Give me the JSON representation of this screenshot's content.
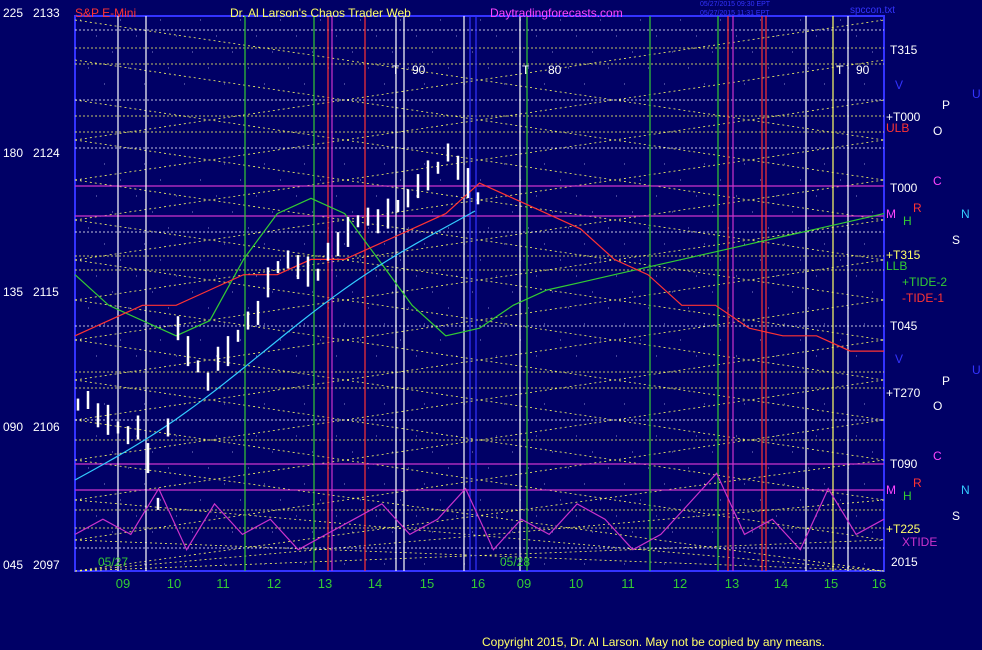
{
  "header": {
    "symbol": "S&P E-Mini",
    "title": "Dr. Al Larson's Chaos Trader Web",
    "site": "Daytradingforecasts.com",
    "stamp_line1": "05/27/2015 09:30 EPT",
    "stamp_line2": "05/27/2015 11:31 EPT",
    "file": "spccon.txt"
  },
  "footer": {
    "copyright": "Copyright 2015, Dr. Al Larson. May not be copied by any means."
  },
  "colors": {
    "background": "#000066",
    "frame": "#3333ff",
    "price": "#ffffff",
    "tide2": "#33cc33",
    "tide1": "#ff3333",
    "xtide": "#cc33cc",
    "cyan": "#33ccff",
    "yellow": "#ffff66",
    "magenta_label": "#ff44ff"
  },
  "chart_data": {
    "type": "line",
    "title": "S&P E-Mini",
    "xlabel": "",
    "ylabel": "",
    "ylim": [
      2097,
      2133
    ],
    "y_ticks": [
      {
        "deg": "225",
        "price": 2133
      },
      {
        "deg": "180",
        "price": 2124
      },
      {
        "deg": "135",
        "price": 2115
      },
      {
        "deg": "090",
        "price": 2106
      },
      {
        "deg": "045",
        "price": 2097
      }
    ],
    "x_hours": [
      "09",
      "10",
      "11",
      "12",
      "13",
      "14",
      "15",
      "16",
      "09",
      "10",
      "11",
      "12",
      "13",
      "14",
      "15",
      "16"
    ],
    "dates": [
      "05/27",
      "05/28"
    ],
    "year": "2015",
    "cycle_labels": [
      {
        "text": "T",
        "value": "90"
      },
      {
        "text": "T",
        "value": "80"
      },
      {
        "text": "T",
        "value": "90"
      }
    ],
    "right_labels": [
      {
        "text": "T315",
        "color": "#ffffff"
      },
      {
        "text": "+T000",
        "color": "#ffffff"
      },
      {
        "text": "ULB",
        "color": "#ff3333"
      },
      {
        "text": "T000",
        "color": "#ffffff"
      },
      {
        "text": "+T315",
        "color": "#ffff66"
      },
      {
        "text": "LLB",
        "color": "#33cc33"
      },
      {
        "text": "+TIDE-2",
        "color": "#33cc33"
      },
      {
        "text": "-TIDE-1",
        "color": "#ff3333"
      },
      {
        "text": "T045",
        "color": "#ffffff"
      },
      {
        "text": "+T270",
        "color": "#ffffff"
      },
      {
        "text": "T090",
        "color": "#ffffff"
      },
      {
        "text": "+T225",
        "color": "#ffff66"
      },
      {
        "text": "XTIDE",
        "color": "#cc33cc"
      }
    ],
    "planet_letters": [
      {
        "text": "V",
        "color": "#3333ff"
      },
      {
        "text": "P",
        "color": "#ffffff"
      },
      {
        "text": "U",
        "color": "#3333ff"
      },
      {
        "text": "O",
        "color": "#ffffff"
      },
      {
        "text": "C",
        "color": "#ff44ff"
      },
      {
        "text": "M",
        "color": "#ff44ff"
      },
      {
        "text": "R",
        "color": "#ff3333"
      },
      {
        "text": "H",
        "color": "#33cc33"
      },
      {
        "text": "N",
        "color": "#33ccff"
      },
      {
        "text": "S",
        "color": "#ffffff"
      }
    ],
    "series": [
      {
        "name": "S&P E-Mini",
        "values": [
          2107.5,
          2107.8,
          2106.8,
          2106.5,
          2106.0,
          2105.5,
          2106.0,
          2104.0,
          2101.0,
          2106.0,
          2112.5,
          2111.0,
          2110.0,
          2109.0,
          2110.5,
          2111.0,
          2112.0,
          2113.0,
          2113.5,
          2115.5,
          2116.5,
          2117.0,
          2116.5,
          2116.2,
          2116.0,
          2117.5,
          2118.0,
          2118.8,
          2119.5,
          2119.8,
          2119.5,
          2120.0,
          2120.5,
          2121.0,
          2121.8,
          2122.5,
          2123.0,
          2124.0,
          2123.0,
          2122.0,
          2121.0
        ]
      },
      {
        "name": "+TIDE-2",
        "values": [
          2116,
          2114,
          2113,
          2112,
          2113,
          2117,
          2120,
          2121,
          2120,
          2117,
          2114,
          2112,
          2112.5,
          2114,
          2115,
          2115.5,
          2116,
          2116.5,
          2117,
          2117.5,
          2118,
          2118.5,
          2119,
          2119.5,
          2120
        ]
      },
      {
        "name": "-TIDE-1",
        "values": [
          2112,
          2113,
          2114,
          2114,
          2115,
          2116,
          2116,
          2117,
          2117,
          2118,
          2119,
          2120,
          2122,
          2121,
          2120,
          2119,
          2117,
          2116,
          2114,
          2114,
          2112.5,
          2112,
          2112,
          2111,
          2111
        ]
      },
      {
        "name": "XTIDE",
        "values": [
          2099,
          2100,
          2099,
          2102,
          2098,
          2101,
          2099,
          2100,
          2098,
          2099,
          2100,
          2101,
          2099,
          2100,
          2102,
          2098,
          2100,
          2099,
          2101,
          2100,
          2098,
          2099,
          2101,
          2103,
          2099,
          2100,
          2098,
          2102,
          2099,
          2100
        ]
      }
    ]
  }
}
